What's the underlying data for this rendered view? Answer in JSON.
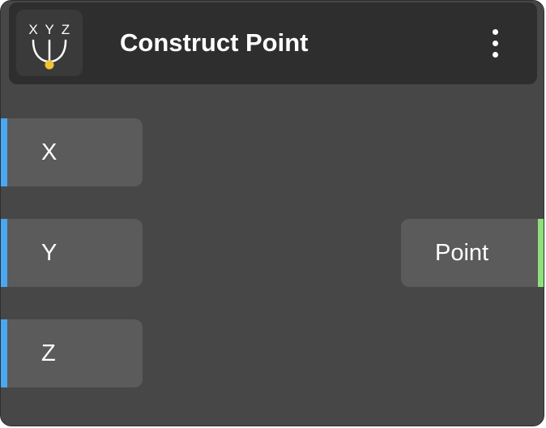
{
  "node": {
    "title": "Construct Point",
    "icon": {
      "name": "construct-point-icon",
      "letters": [
        "X",
        "Y",
        "Z"
      ],
      "accent_color": "#f2c230"
    },
    "menu_icon": "more-vertical-icon",
    "inputs": [
      {
        "label": "X",
        "color": "#4aa7f0"
      },
      {
        "label": "Y",
        "color": "#4aa7f0"
      },
      {
        "label": "Z",
        "color": "#4aa7f0"
      }
    ],
    "outputs": [
      {
        "label": "Point",
        "color": "#8fe07c"
      }
    ]
  }
}
